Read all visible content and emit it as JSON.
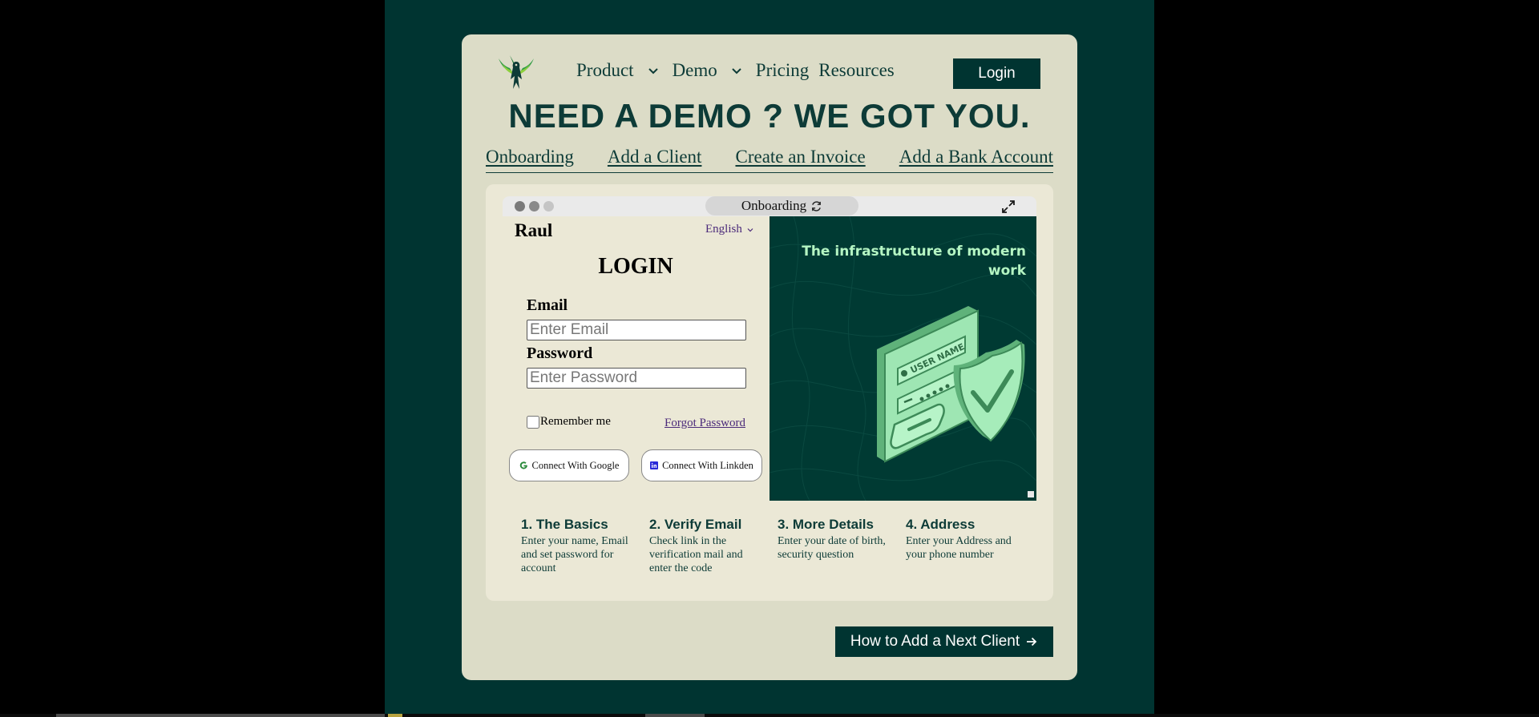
{
  "nav": {
    "items": [
      {
        "label": "Product",
        "has_dropdown": true
      },
      {
        "label": "Demo",
        "has_dropdown": true
      },
      {
        "label": "Pricing",
        "has_dropdown": false
      },
      {
        "label": "Resources",
        "has_dropdown": false
      }
    ],
    "login_label": "Login",
    "logo_icon": "eagle-logo-icon"
  },
  "headline": "NEED A DEMO ? WE GOT YOU.",
  "tabs": [
    "Onboarding",
    "Add a Client",
    "Create an Invoice",
    "Add a Bank Account"
  ],
  "demo": {
    "address_label": "Onboarding",
    "brand": "Raul",
    "language": "English",
    "login_title": "LOGIN",
    "email_label": "Email",
    "email_placeholder": "Enter Email",
    "password_label": "Password",
    "password_placeholder": "Enter Password",
    "remember_label": "Remember me",
    "forgot_label": "Forgot Password",
    "google_label": "Connect With Google",
    "linkedin_label": "Connect With Linkden",
    "promo_text": "The infrastructure of modern work",
    "illustration_text": "USER NAME"
  },
  "steps": [
    {
      "title": "1. The Basics",
      "desc": "Enter your name, Email and set password for account"
    },
    {
      "title": "2. Verify Email",
      "desc": "Check link in the verification mail and enter the code"
    },
    {
      "title": "3. More Details",
      "desc": "Enter your date of birth, security question"
    },
    {
      "title": "4. Address",
      "desc": "Enter your Address and your phone number"
    }
  ],
  "next_button_label": "How to Add a Next Client",
  "colors": {
    "page_bg": "#000000",
    "brand_dark": "#003431",
    "card_bg": "#dcdcc7",
    "panel_bg": "#ebe8d6",
    "accent_green": "#b5f5c3"
  }
}
